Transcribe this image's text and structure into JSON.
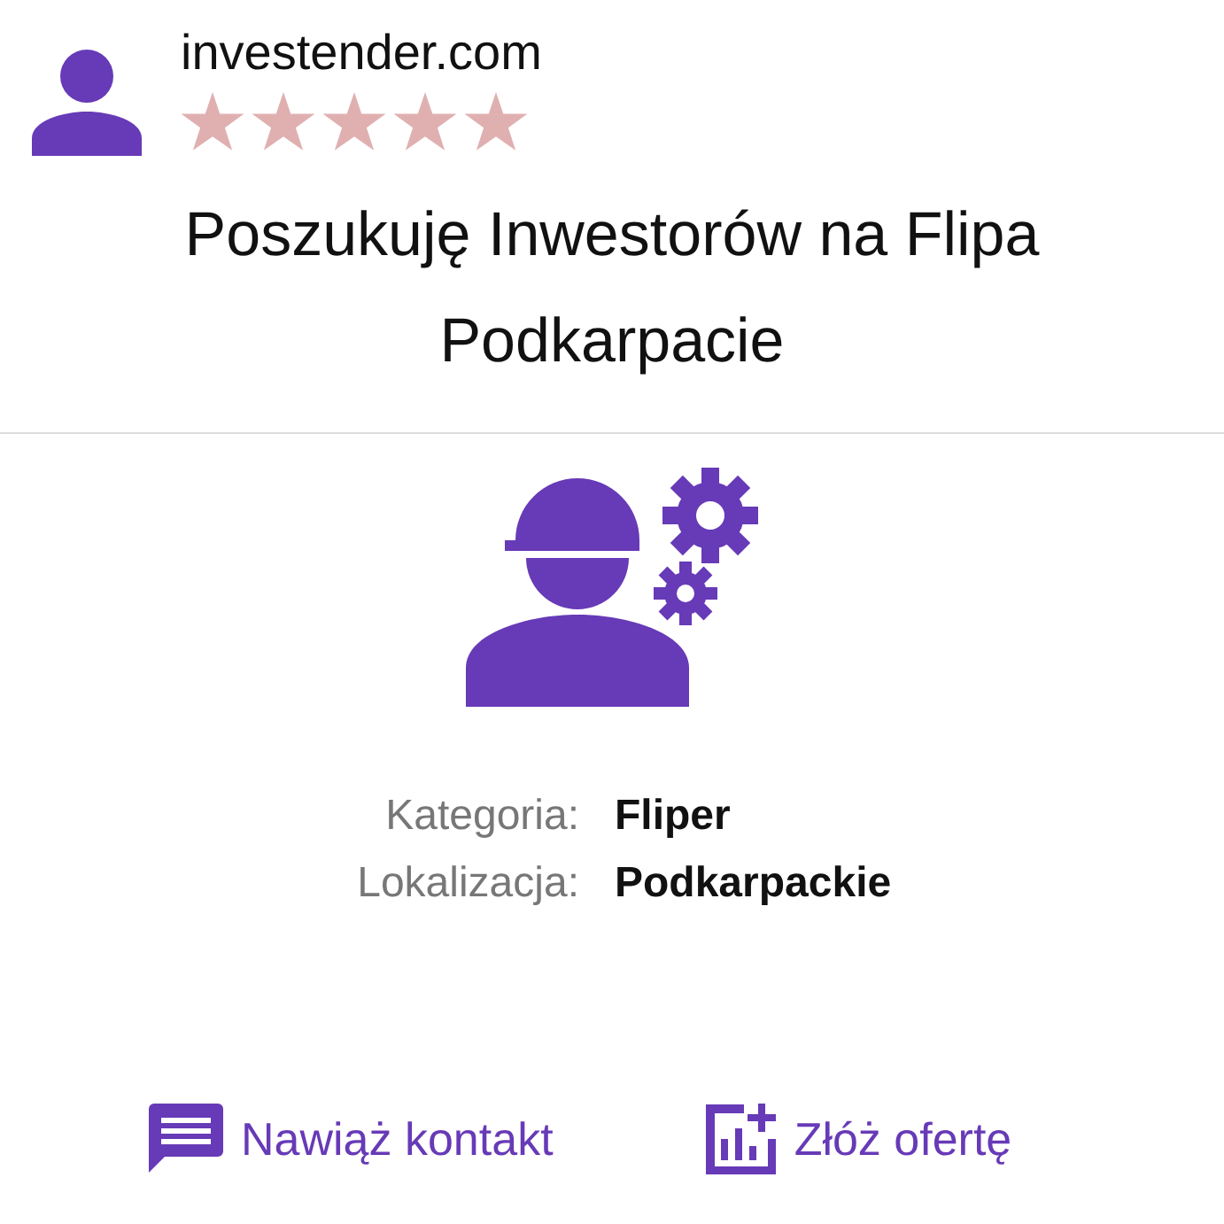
{
  "header": {
    "site": "investender.com",
    "stars": 5
  },
  "title": "Poszukuję Inwestorów na Flipa Podkarpacie",
  "details": [
    {
      "label": "Kategoria:",
      "value": "Fliper"
    },
    {
      "label": "Lokalizacja:",
      "value": "Podkarpackie"
    }
  ],
  "actions": [
    {
      "kind": "contact",
      "label": "Nawiąż kontakt"
    },
    {
      "kind": "offer",
      "label": "Złóż ofertę"
    }
  ]
}
